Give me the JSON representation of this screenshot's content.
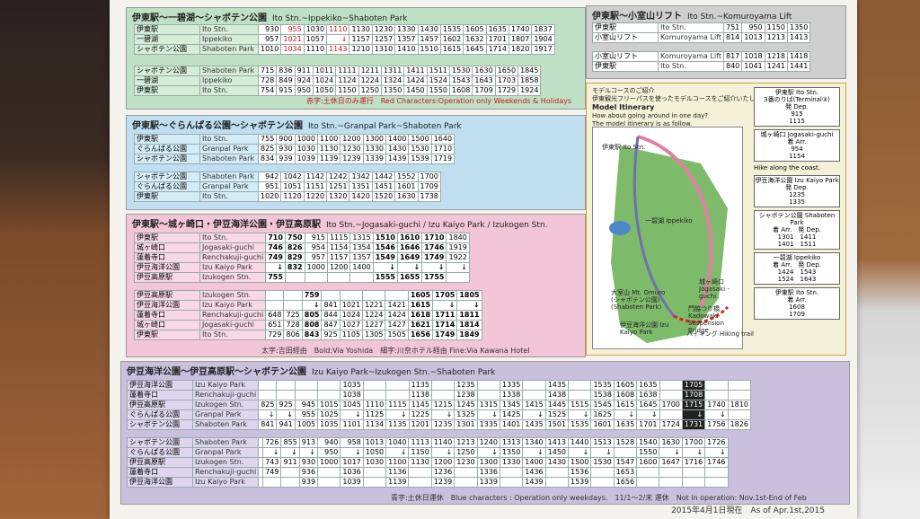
{
  "s1": {
    "title": "伊東駅〜一碧湖〜シャボテン公園",
    "title_en": "Ito Stn.~Ippekiko~Shaboten Park",
    "out_rows": [
      {
        "j": "伊東駅",
        "e": "Ito Stn.",
        "t": [
          "930",
          "955",
          "1030",
          "1110",
          "1130",
          "1230",
          "1330",
          "1430",
          "1535",
          "1605",
          "1635",
          "1740",
          "1837"
        ]
      },
      {
        "j": "一碧湖",
        "e": "Ippekiko",
        "t": [
          "957",
          "1021",
          "1057",
          "↓",
          "1157",
          "1257",
          "1357",
          "1457",
          "1602",
          "1632",
          "1701",
          "1807",
          "1904"
        ]
      },
      {
        "j": "シャボテン公園",
        "e": "Shaboten Park",
        "t": [
          "1010",
          "1034",
          "1110",
          "1143",
          "1210",
          "1310",
          "1410",
          "1510",
          "1615",
          "1645",
          "1714",
          "1820",
          "1917"
        ]
      }
    ],
    "in_rows": [
      {
        "j": "シャボテン公園",
        "e": "Shaboten Park",
        "t": [
          "715",
          "836",
          "911",
          "1011",
          "1111",
          "1211",
          "1311",
          "1411",
          "1511",
          "1530",
          "1630",
          "1650",
          "1845"
        ]
      },
      {
        "j": "一碧湖",
        "e": "Ippekiko",
        "t": [
          "728",
          "849",
          "924",
          "1024",
          "1124",
          "1224",
          "1324",
          "1424",
          "1524",
          "1543",
          "1643",
          "1703",
          "1858"
        ]
      },
      {
        "j": "伊東駅",
        "e": "Ito Stn.",
        "t": [
          "754",
          "915",
          "950",
          "1050",
          "1150",
          "1250",
          "1350",
          "1450",
          "1550",
          "1608",
          "1709",
          "1729",
          "1924"
        ]
      }
    ],
    "note": "赤字:土休日のみ運行　Red Characters:Operation only Weekends & Holidays"
  },
  "s2": {
    "title": "伊東駅〜ぐらんぱる公園〜シャボテン公園",
    "title_en": "Ito Stn.~Granpal Park~Shaboten Park",
    "out_rows": [
      {
        "j": "伊東駅",
        "e": "Ito Stn.",
        "t": [
          "755",
          "900",
          "1000",
          "1100",
          "1200",
          "1300",
          "1400",
          "1500",
          "1640"
        ]
      },
      {
        "j": "ぐらんぱる公園",
        "e": "Granpal Park",
        "t": [
          "825",
          "930",
          "1030",
          "1130",
          "1230",
          "1330",
          "1430",
          "1530",
          "1710"
        ]
      },
      {
        "j": "シャボテン公園",
        "e": "Shaboten Park",
        "t": [
          "834",
          "939",
          "1039",
          "1139",
          "1239",
          "1339",
          "1439",
          "1539",
          "1719"
        ]
      }
    ],
    "in_rows": [
      {
        "j": "シャボテン公園",
        "e": "Shaboten Park",
        "t": [
          "942",
          "1042",
          "1142",
          "1242",
          "1342",
          "1442",
          "1552",
          "1700"
        ]
      },
      {
        "j": "ぐらんぱる公園",
        "e": "Granpal Park",
        "t": [
          "951",
          "1051",
          "1151",
          "1251",
          "1351",
          "1451",
          "1601",
          "1709"
        ]
      },
      {
        "j": "伊東駅",
        "e": "Ito Stn.",
        "t": [
          "1020",
          "1120",
          "1220",
          "1320",
          "1420",
          "1520",
          "1630",
          "1738"
        ]
      }
    ]
  },
  "s3": {
    "title": "伊東駅〜城ヶ崎口・伊豆海洋公園・伊豆高原駅",
    "title_en": "Ito Stn.~Jogasaki-guchi / Izu Kaiyo Park / Izukogen Stn.",
    "out_rows": [
      {
        "j": "伊東駅",
        "e": "Ito Stn.",
        "t": [
          "710",
          "750",
          "915",
          "1115",
          "1315",
          "1510",
          "1610",
          "1710",
          "1840"
        ]
      },
      {
        "j": "城ヶ崎口",
        "e": "Jogasaki-guchi",
        "t": [
          "746",
          "826",
          "954",
          "1154",
          "1354",
          "1546",
          "1646",
          "1746",
          "1919"
        ]
      },
      {
        "j": "蓮着寺口",
        "e": "Renchakuji-guchi",
        "t": [
          "749",
          "829",
          "957",
          "1157",
          "1357",
          "1549",
          "1649",
          "1749",
          "1922"
        ]
      },
      {
        "j": "伊豆海洋公園",
        "e": "Izu Kaiyo Park",
        "t": [
          "↓",
          "832",
          "1000",
          "1200",
          "1400",
          "↓",
          "↓",
          "↓",
          "↓"
        ]
      },
      {
        "j": "伊豆高原駅",
        "e": "Izukogen Stn.",
        "t": [
          "755",
          "",
          "",
          "",
          "",
          "1555",
          "1655",
          "1755",
          ""
        ]
      }
    ],
    "in_rows": [
      {
        "j": "伊豆高原駅",
        "e": "Izukogen Stn.",
        "t": [
          "",
          "",
          "759",
          "",
          "",
          "",
          "",
          "1605",
          "1705",
          "1805"
        ]
      },
      {
        "j": "伊豆海洋公園",
        "e": "Izu Kaiyo Park",
        "t": [
          "",
          "",
          "↓",
          "841",
          "1021",
          "1221",
          "1421",
          "1615",
          "↓",
          "↓"
        ]
      },
      {
        "j": "蓮着寺口",
        "e": "Renchakuji-guchi",
        "t": [
          "648",
          "725",
          "805",
          "844",
          "1024",
          "1224",
          "1424",
          "1618",
          "1711",
          "1811"
        ]
      },
      {
        "j": "城ヶ崎口",
        "e": "Jogasaki-guchi",
        "t": [
          "651",
          "728",
          "808",
          "847",
          "1027",
          "1227",
          "1427",
          "1621",
          "1714",
          "1814"
        ]
      },
      {
        "j": "伊東駅",
        "e": "Ito Stn.",
        "t": [
          "729",
          "806",
          "843",
          "925",
          "1105",
          "1305",
          "1505",
          "1656",
          "1749",
          "1849"
        ]
      }
    ],
    "note": "太字:吉田経由　Bold:Via Yoshida　細字:川奈ホテル経由 Fine:Via Kawana Hotel"
  },
  "s4": {
    "title": "伊豆海洋公園〜伊豆高原駅〜シャボテン公園",
    "title_en": "Izu Kaiyo Park~Izukogen Stn.~Shaboten Park",
    "out_rows": [
      {
        "j": "伊豆海洋公園",
        "e": "Izu Kaiyo Park",
        "t": [
          "",
          "",
          "",
          "",
          "1035",
          "",
          "",
          "1135",
          "",
          "1235",
          "",
          "1335",
          "",
          "1435",
          "",
          "1535",
          "1605",
          "1635",
          "",
          "1705",
          "",
          ""
        ]
      },
      {
        "j": "蓮着寺口",
        "e": "Renchakuji-guchi",
        "t": [
          "",
          "",
          "",
          "",
          "1038",
          "",
          "",
          "1138",
          "",
          "1238",
          "",
          "1338",
          "",
          "1438",
          "",
          "1538",
          "1608",
          "1638",
          "",
          "1708",
          "",
          ""
        ]
      },
      {
        "j": "伊豆高原駅",
        "e": "Izukogen Stn.",
        "t": [
          "825",
          "925",
          "945",
          "1015",
          "1045",
          "1110",
          "1115",
          "1145",
          "1215",
          "1245",
          "1315",
          "1345",
          "1415",
          "1445",
          "1515",
          "1545",
          "1615",
          "1645",
          "1700",
          "1715",
          "1740",
          "1810"
        ]
      },
      {
        "j": "ぐらんぱる公園",
        "e": "Granpal Park",
        "t": [
          "↓",
          "↓",
          "955",
          "1025",
          "↓",
          "1125",
          "↓",
          "1225",
          "↓",
          "1325",
          "↓",
          "1425",
          "↓",
          "1525",
          "↓",
          "1625",
          "↓",
          "↓",
          "",
          "↓",
          "↓",
          ""
        ]
      },
      {
        "j": "シャボテン公園",
        "e": "Shaboten Park",
        "t": [
          "841",
          "941",
          "1005",
          "1035",
          "1101",
          "1134",
          "1135",
          "1201",
          "1235",
          "1301",
          "1335",
          "1401",
          "1435",
          "1501",
          "1535",
          "1601",
          "1635",
          "1701",
          "1724",
          "1731",
          "1756",
          "1826"
        ]
      }
    ],
    "in_rows": [
      {
        "j": "シャボテン公園",
        "e": "Shaboten Park",
        "t": [
          "",
          "726",
          "855",
          "913",
          "940",
          "958",
          "1013",
          "1040",
          "1113",
          "1140",
          "1213",
          "1240",
          "1313",
          "1340",
          "1413",
          "1440",
          "1513",
          "1528",
          "1540",
          "1630",
          "1700",
          "1726"
        ]
      },
      {
        "j": "ぐらんぱる公園",
        "e": "Granpal Park",
        "t": [
          "",
          "↓",
          "↓",
          "↓",
          "950",
          "↓",
          "1050",
          "↓",
          "1150",
          "↓",
          "1250",
          "↓",
          "1350",
          "↓",
          "1450",
          "↓",
          "↓",
          "",
          "1550",
          "↓",
          "↓",
          "↓"
        ]
      },
      {
        "j": "伊豆高原駅",
        "e": "Izukogen Stn.",
        "t": [
          "",
          "743",
          "911",
          "930",
          "1000",
          "1017",
          "1030",
          "1100",
          "1130",
          "1200",
          "1230",
          "1300",
          "1330",
          "1400",
          "1430",
          "1500",
          "1530",
          "1547",
          "1600",
          "1647",
          "1716",
          "1746"
        ]
      },
      {
        "j": "蓮着寺口",
        "e": "Renchakuji-guchi",
        "t": [
          "",
          "749",
          "",
          "936",
          "",
          "1036",
          "",
          "1136",
          "",
          "1236",
          "",
          "1336",
          "",
          "1436",
          "",
          "1536",
          "",
          "1653",
          "",
          "",
          "",
          ""
        ]
      },
      {
        "j": "伊豆海洋公園",
        "e": "Izu Kaiyo Park",
        "t": [
          "",
          "",
          "",
          "939",
          "",
          "1039",
          "",
          "1139",
          "",
          "1239",
          "",
          "1339",
          "",
          "1439",
          "",
          "1539",
          "",
          "1656",
          "",
          "",
          "",
          ""
        ]
      }
    ],
    "note": "青字:土休日運休　Blue characters : Operation only weekdays.　11/1〜2/末 運休　Not in operation: Nov.1st-End of Feb"
  },
  "s5": {
    "title": "伊東駅〜小室山リフト",
    "title_en": "Ito Stn.~Komuroyama Lift",
    "out_rows": [
      {
        "j": "伊東駅",
        "e": "Ito Stn.",
        "t": [
          "751",
          "950",
          "1150",
          "1350"
        ]
      },
      {
        "j": "小室山リフト",
        "e": "Komuroyama Lift",
        "t": [
          "814",
          "1013",
          "1213",
          "1413"
        ]
      }
    ],
    "in_rows": [
      {
        "j": "小室山リフト",
        "e": "Komuroyama Lift",
        "t": [
          "817",
          "1018",
          "1218",
          "1418"
        ]
      },
      {
        "j": "伊東駅",
        "e": "Ito Stn.",
        "t": [
          "840",
          "1041",
          "1241",
          "1441"
        ]
      }
    ]
  },
  "s6": {
    "jp1": "モデルコースのご紹介",
    "jp2": "伊東観光フリーパスを使ったモデルコースをご紹介いたします。",
    "en_title": "Model Itinerary",
    "en1": "How about going around in one day?",
    "en2": "The model itinerary is as follow.",
    "hike": "Hike along the coast.",
    "boxes": [
      {
        "a": "伊東駅 Ito Stn.",
        "b": "3番のりば(Terminal③)",
        "c": "発 Dep.",
        "d": "915",
        "e": "1115"
      },
      {
        "a": "城ヶ崎口 Jogasaki-guchi",
        "b": "",
        "c": "着 Arr.",
        "d": "954",
        "e": "1154"
      },
      {
        "a": "伊豆海洋公園 Izu Kaiyo Park",
        "b": "",
        "c": "発 Dep.",
        "d": "1235",
        "e": "1335"
      },
      {
        "a": "シャボテン公園 Shaboten Park",
        "b": "着 Arr.　発 Dep.",
        "c": "",
        "d": "1301　1411",
        "e": "1401　1511"
      },
      {
        "a": "一碧湖 Ippekiko",
        "b": "着 Arr.　発 Dep.",
        "c": "",
        "d": "1424　1543",
        "e": "1524　1643"
      },
      {
        "a": "伊東駅 Ito Stn.",
        "b": "",
        "c": "着 Arr.",
        "d": "1608",
        "e": "1709"
      }
    ],
    "map": {
      "ito": "伊東駅 Ito Stn.",
      "ippeki": "一碧湖 Ippekiko",
      "omuro": "大室山 Mt. Omuro (シャボテン公園) (Shaboten Park)",
      "jogasaki": "城ヶ崎口 Jogasaki -guchi",
      "bridge": "門脇つり橋 Kadowaki Suspension Bridge",
      "kaiyo": "伊豆海洋公園 Izu Kaiyo Park",
      "hiking": "ハイキング Hiking trail"
    }
  },
  "footer": "2015年4月1日現在　As of Apr.1st,2015",
  "colors": {
    "red": "#c01818",
    "weekday_blue": "#2040c0"
  }
}
